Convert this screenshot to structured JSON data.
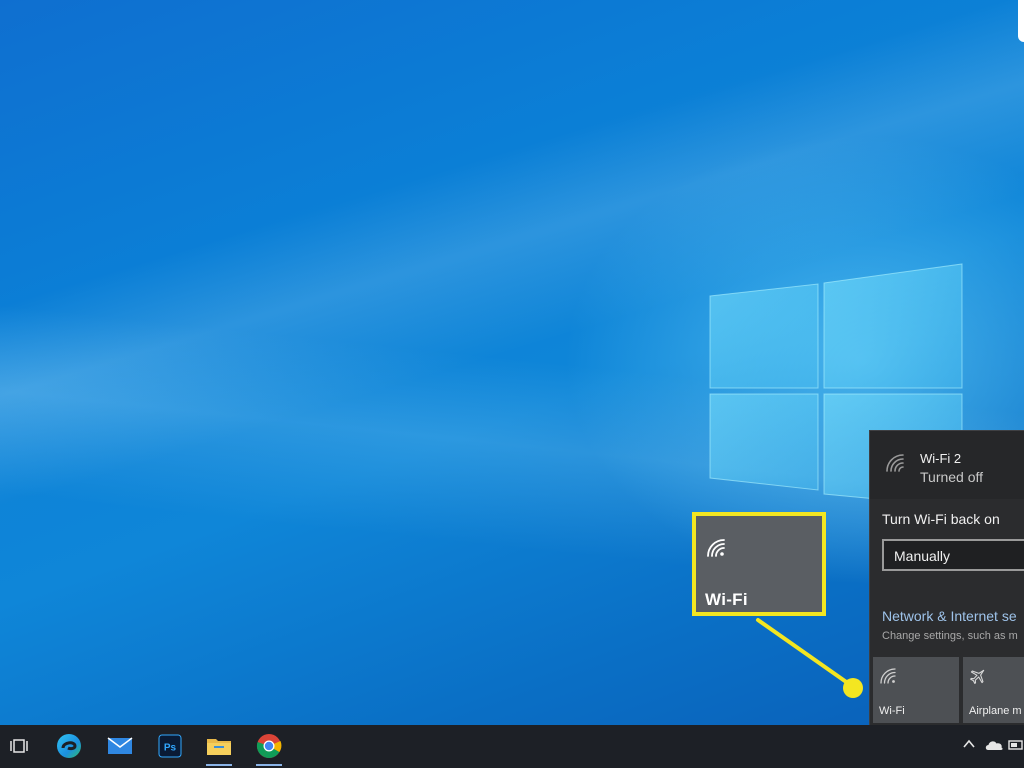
{
  "flyout": {
    "network_name": "Wi-Fi 2",
    "network_status": "Turned off",
    "turn_back_label": "Turn Wi-Fi back on",
    "turn_back_value": "Manually",
    "settings_link": "Network & Internet se",
    "settings_sub": "Change settings, such as m",
    "quick_actions": [
      {
        "label": "Wi-Fi",
        "icon": "wifi-icon"
      },
      {
        "label": "Airplane m",
        "icon": "airplane-icon"
      }
    ]
  },
  "callout": {
    "label": "Wi-Fi",
    "icon": "wifi-icon",
    "color": "#f3e621"
  },
  "taskbar": {
    "apps": [
      {
        "name": "task-view",
        "icon": "task-view-icon"
      },
      {
        "name": "edge",
        "icon": "edge-icon"
      },
      {
        "name": "mail",
        "icon": "mail-icon"
      },
      {
        "name": "photoshop",
        "icon": "photoshop-icon",
        "text": "Ps"
      },
      {
        "name": "file-explorer",
        "icon": "folder-icon"
      },
      {
        "name": "chrome",
        "icon": "chrome-icon"
      }
    ],
    "tray": [
      "chevron-up-icon",
      "onedrive-cloud-icon",
      "battery-icon"
    ]
  },
  "colors": {
    "desktop": "#0b7fd6",
    "taskbar": "#1d2026",
    "flyout": "#2b2c2e",
    "tile": "#4d5054",
    "highlight": "#f3e621"
  }
}
